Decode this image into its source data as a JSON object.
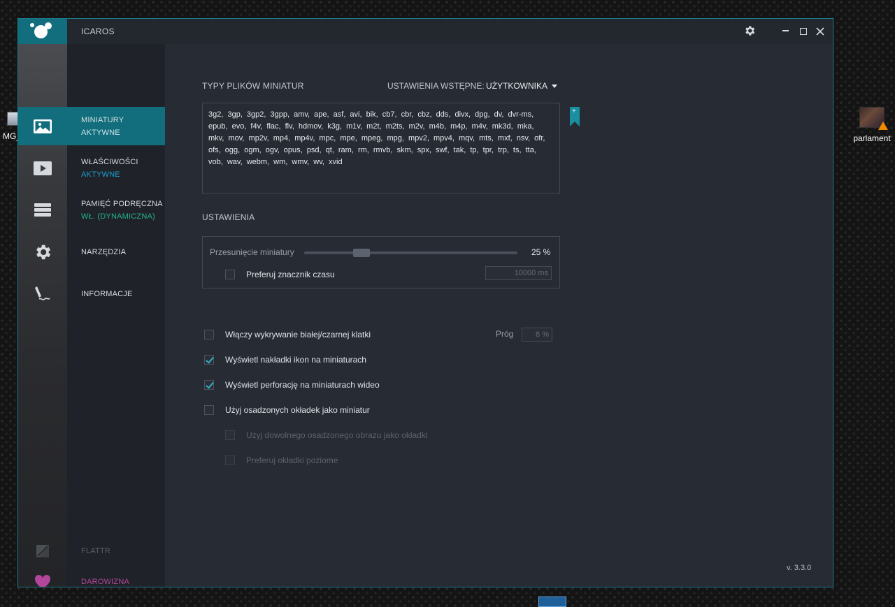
{
  "desktop": {
    "left_icon_label": "MG_",
    "right_icon_label": "parlament"
  },
  "window": {
    "title": "ICAROS"
  },
  "nav": {
    "items": [
      {
        "title": "MINIATURY",
        "status": "AKTYWNE"
      },
      {
        "title": "WŁAŚCIWOŚCI",
        "status": "AKTYWNE"
      },
      {
        "title": "PAMIĘĆ PODRĘCZNA",
        "status": "WŁ. (DYNAMICZNA)"
      },
      {
        "title": "NARZĘDZIA",
        "status": ""
      },
      {
        "title": "INFORMACJE",
        "status": ""
      }
    ],
    "flattr": "FLATTR",
    "donate": "DAROWIZNA"
  },
  "main": {
    "types_heading": "TYPY PLIKÓW MINIATUR",
    "preset_label": "USTAWIENIA WSTĘPNE:",
    "preset_value": "UŻYTKOWNIKA",
    "file_types": "3g2, 3gp, 3gp2, 3gpp, amv, ape, asf, avi, bik, cb7, cbr, cbz, dds, divx, dpg, dv, dvr-ms, epub, evo, f4v, flac, flv, hdmov, k3g, m1v, m2t, m2ts, m2v, m4b, m4p, m4v, mk3d, mka, mkv, mov, mp2v, mp4, mp4v, mpc, mpe, mpeg, mpg, mpv2, mpv4, mqv, mts, mxf, nsv, ofr, ofs, ogg, ogm, ogv, opus, psd, qt, ram, rm, rmvb, skm, spx, swf, tak, tp, tpr, trp, ts, tta, vob, wav, webm, wm, wmv, wv, xvid",
    "settings_heading": "USTAWIENIA",
    "offset_label": "Przesunięcie miniatury",
    "offset_value": "25 %",
    "offset_fraction": 0.25,
    "prefer_timestamp_label": "Preferuj znacznik czasu",
    "timestamp_placeholder": "10000 ms",
    "options": [
      {
        "label": "Włączy wykrywanie białej/czarnej klatki",
        "checked": false
      },
      {
        "label": "Wyświetl nakładki ikon na miniaturach",
        "checked": true
      },
      {
        "label": "Wyświetl perforację na miniaturach wideo",
        "checked": true
      },
      {
        "label": "Użyj osadzonych okładek jako miniatur",
        "checked": false
      }
    ],
    "sub_options": [
      {
        "label": "Użyj dowolnego osadzonego obrazu jako okładki",
        "checked": false
      },
      {
        "label": "Preferuj okładki poziome",
        "checked": false
      }
    ],
    "threshold_label": "Próg",
    "threshold_placeholder": "8 %",
    "version": "v. 3.3.0"
  },
  "colors": {
    "accent": "#126e7c",
    "check": "#2fb0c6",
    "donate": "#b3459a",
    "status_blue": "#1a9fd0",
    "status_green": "#26b38a"
  }
}
